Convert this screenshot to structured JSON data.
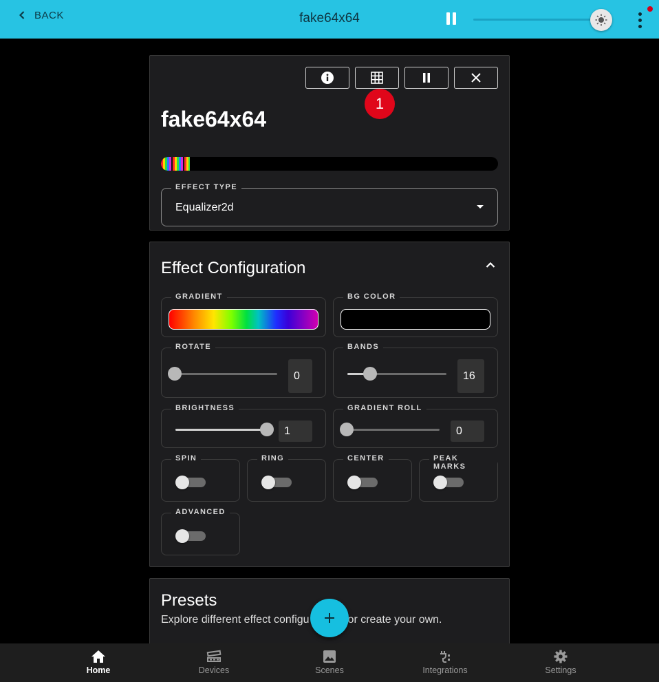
{
  "topbar": {
    "back_label": "BACK",
    "title": "fake64x64"
  },
  "device_card": {
    "name": "fake64x64",
    "badge": "1",
    "effect_type_label": "EFFECT TYPE",
    "effect_type_value": "Equalizer2d"
  },
  "config": {
    "title": "Effect Configuration",
    "gradient_label": "GRADIENT",
    "bg_color_label": "BG COLOR",
    "bg_color": "#000000",
    "rotate": {
      "label": "ROTATE",
      "value": "0"
    },
    "bands": {
      "label": "BANDS",
      "value": "16"
    },
    "brightness": {
      "label": "BRIGHTNESS",
      "value": "1"
    },
    "gradient_roll": {
      "label": "GRADIENT ROLL",
      "value": "0"
    },
    "toggles": {
      "spin": "SPIN",
      "ring": "RING",
      "center": "CENTER",
      "peak_marks": "PEAK MARKS",
      "advanced": "ADVANCED"
    }
  },
  "presets": {
    "title": "Presets",
    "subtitle": "Explore different effect configu",
    "subtitle_tail": "or create your own."
  },
  "fab": {
    "label": "+"
  },
  "bottom_nav": {
    "home": "Home",
    "devices": "Devices",
    "scenes": "Scenes",
    "integrations": "Integrations",
    "settings": "Settings"
  },
  "colors": {
    "accent": "#27c3e3",
    "badge": "#e0061a",
    "card": "#1d1d1f"
  }
}
